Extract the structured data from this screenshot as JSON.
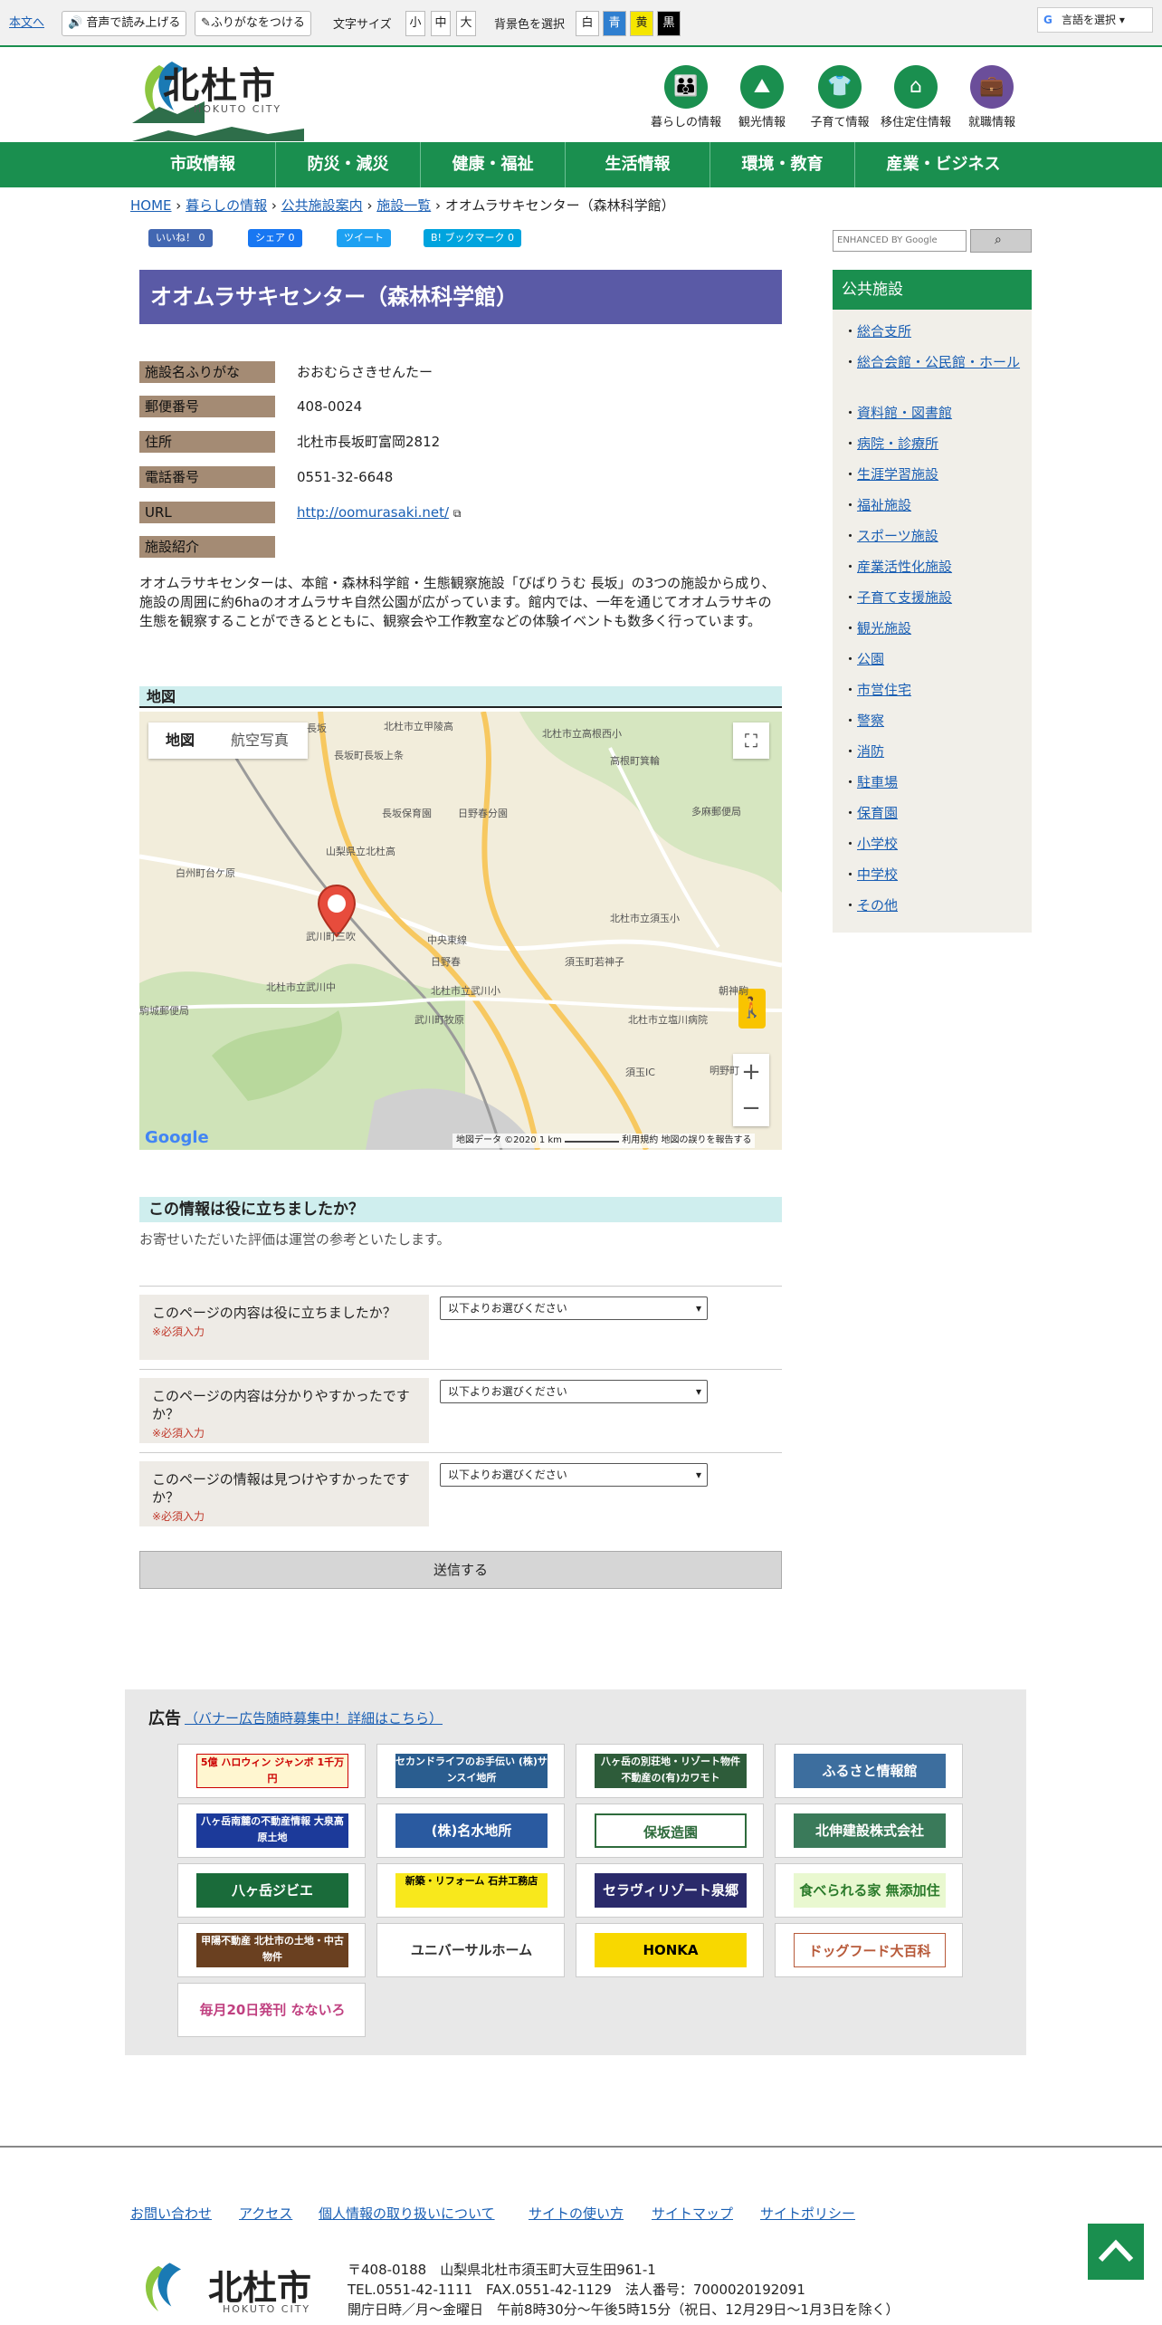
{
  "topbar": {
    "skip": "本文へ",
    "read_aloud": "音声で読み上げる",
    "furigana": "ふりがなをつける",
    "text_size_label": "文字サイズ",
    "sizes": [
      "小",
      "中",
      "大"
    ],
    "bg_label": "背景色を選択",
    "bg_options": [
      "白",
      "青",
      "黄",
      "黒"
    ],
    "bg_colors": [
      "#ffffff",
      "#2f7fd0",
      "#f5e600",
      "#000000"
    ],
    "language": "言語を選択"
  },
  "header": {
    "logo": "北杜市",
    "logo_sub": "HOKUTO CITY",
    "icons": [
      {
        "label": "暮らしの情報",
        "icon": "people-icon"
      },
      {
        "label": "観光情報",
        "icon": "mountain-icon"
      },
      {
        "label": "子育て情報",
        "icon": "child-icon"
      },
      {
        "label": "移住定住情報",
        "icon": "house-icon"
      },
      {
        "label": "就職情報",
        "icon": "briefcase-icon"
      }
    ]
  },
  "nav": [
    "市政情報",
    "防災・減災",
    "健康・福祉",
    "生活情報",
    "環境・教育",
    "産業・ビジネス"
  ],
  "breadcrumb": {
    "home": "HOME",
    "l1": "暮らしの情報",
    "l2": "公共施設案内",
    "l3": "施設一覧",
    "current": "オオムラサキセンター（森林科学館）",
    "sep": "›"
  },
  "social": {
    "like": "いいね！ 0",
    "share": "シェア 0",
    "tweet": "ツイート",
    "bookmark": "B! ブックマーク 0"
  },
  "page_title": "オオムラサキセンター（森林科学館）",
  "facility": {
    "furigana_label": "施設名ふりがな",
    "furigana": "おおむらさきせんたー",
    "postal_label": "郵便番号",
    "postal": "408-0024",
    "address_label": "住所",
    "address": "北杜市長坂町富岡2812",
    "phone_label": "電話番号",
    "phone": "0551-32-6648",
    "url_label": "URL",
    "url": "http://oomurasaki.net/",
    "intro_label": "施設紹介",
    "description": "オオムラサキセンターは、本館・森林科学館・生態観察施設「びばりうむ 長坂」の3つの施設から成り、施設の周囲に約6haのオオムラサキ自然公園が広がっています。館内では、一年を通じてオオムラサキの生態を観察することができるとともに、観察会や工作教室などの体験イベントも数多く行っています。"
  },
  "map": {
    "heading": "地図",
    "tab_map": "地図",
    "tab_sat": "航空写真",
    "google": "Google",
    "attribution": "地図データ ©2020",
    "scale": "1 km",
    "terms": "利用規約",
    "report": "地図の誤りを報告する",
    "labels": [
      "北杜市立甲陵高",
      "北杜市立高根西小",
      "長坂",
      "長坂町長坂上条",
      "高根町箕輪",
      "長坂保育園",
      "日野春分園",
      "白州町台ケ原",
      "山梨県立北杜高",
      "北杜市立須玉小",
      "武川町三吹",
      "中央東線",
      "日野春",
      "須玉町若神子",
      "駒城郵便局",
      "北杜市立武川中",
      "北杜市立武川小",
      "武川町牧原",
      "北杜市立塩川病院",
      "多麻郵便局",
      "朝神駒",
      "明野町",
      "須玉IC"
    ]
  },
  "feedback": {
    "heading": "この情報は役に立ちましたか？",
    "note": "お寄せいただいた評価は運営の参考といたします。",
    "required": "※必須入力",
    "select_placeholder": "以下よりお選びください",
    "q1": "このページの内容は役に立ちましたか？",
    "q2": "このページの内容は分かりやすかったですか？",
    "q3": "このページの情報は見つけやすかったですか？",
    "submit": "送信する"
  },
  "sidebar": {
    "search_placeholder": "ENHANCED BY Google",
    "heading": "公共施設",
    "items": [
      "総合支所",
      "総合会館・公民館・ホール",
      "資料館・図書館",
      "病院・診療所",
      "生涯学習施設",
      "福祉施設",
      "スポーツ施設",
      "産業活性化施設",
      "子育て支援施設",
      "観光施設",
      "公園",
      "市営住宅",
      "警察",
      "消防",
      "駐車場",
      "保育園",
      "小学校",
      "中学校",
      "その他"
    ]
  },
  "ads": {
    "title": "広告",
    "link": "（バナー広告随時募集中！詳細はこちら）",
    "banners": [
      "5億 ハロウィン ジャンボ 1千万円",
      "セカンドライフのお手伝い (株)サンスイ地所",
      "八ヶ岳の別荘地・リゾート物件 不動産の(有)カワモト",
      "ふるさと情報館",
      "八ヶ岳南麓の不動産情報 大泉高原土地",
      "(株)名水地所",
      "保坂造園",
      "北伸建設株式会社",
      "八ヶ岳ジビエ",
      "新築・リフォーム 石井工務店",
      "セラヴィリゾート泉郷",
      "食べられる家 無添加住宅",
      "甲陽不動産 北杜市の土地・中古物件",
      "ユニバーサルホーム",
      "HONKA",
      "ドッグフード大百科",
      "毎月20日発刊 なないろ"
    ]
  },
  "footer": {
    "links": [
      "お問い合わせ",
      "アクセス",
      "個人情報の取り扱いについて",
      "サイトの使い方",
      "サイトマップ",
      "サイトポリシー"
    ],
    "logo": "北杜市",
    "logo_sub": "HOKUTO CITY",
    "address": "〒408-0188　山梨県北杜市須玉町大豆生田961-1",
    "tel": "TEL.0551-42-1111　FAX.0551-42-1129　法人番号：7000020192091",
    "hours": "開庁日時／月～金曜日　午前8時30分～午後5時15分（祝日、12月29日～1月3日を除く）"
  }
}
